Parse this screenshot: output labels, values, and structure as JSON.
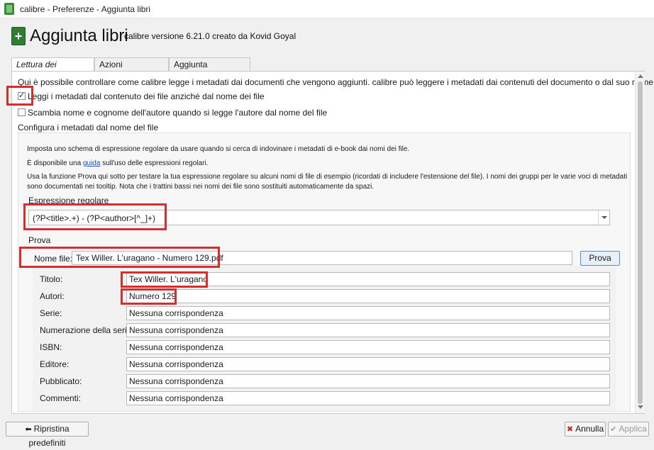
{
  "window": {
    "title": "calibre - Preferenze - Aggiunta libri"
  },
  "header": {
    "title": "Aggiunta libri",
    "subtitle": "calibre versione 6.21.0 creato da Kovid Goyal"
  },
  "tabs": [
    {
      "label": "Lettura dei metadati",
      "active": true
    },
    {
      "label": "Azioni all'aggiunta",
      "active": false
    },
    {
      "label": "Aggiunta automatica",
      "active": false
    }
  ],
  "panel": {
    "intro": "Qui è possibile controllare come calibre legge i metadati dai documenti che vengono aggiunti. calibre può leggere i metadati dai contenuti del documento o dal suo nome.",
    "checkbox_read_from_content": {
      "label": "Leggi i metadati dal contenuto dei file anziché dal nome dei file",
      "checked": true
    },
    "checkbox_swap_author": {
      "label": "Scambia nome e cognome dell'autore quando si legge l'autore dal nome del file",
      "checked": false
    },
    "section_title": "Configura i metadati dal nome del file"
  },
  "group": {
    "desc1": "Imposta uno schema di espressione regolare da usare quando si cerca di indovinare i metadati di e-book dai nomi dei file.",
    "desc2_before": "È disponibile una ",
    "desc2_link": "guida",
    "desc2_after": " sull'uso delle espressioni regolari.",
    "desc3_line1": "Usa la funzione Prova qui sotto per testare la tua espressione regolare su alcuni nomi di file di esempio (ricordati di includere l'estensione del file). I nomi dei gruppi per le varie voci di metadati",
    "desc3_line2": "sono documentati nei tooltip. Nota che i trattini bassi nei nomi dei file sono sostituiti automaticamente da spazi.",
    "regex_label": "Espressione regolare",
    "regex_value": "(?P<title>.+) - (?P<author>[^_]+)",
    "test_label": "Prova",
    "filename_label": "Nome file:",
    "filename_value": "Tex Willer. L'uragano - Numero 129.pdf",
    "test_button": "Prova"
  },
  "results": [
    {
      "label": "Titolo:",
      "value": "Tex Willer. L'uragano"
    },
    {
      "label": "Autori:",
      "value": "Numero 129"
    },
    {
      "label": "Serie:",
      "value": "Nessuna corrispondenza"
    },
    {
      "label": "Numerazione della serie:",
      "value": "Nessuna corrispondenza"
    },
    {
      "label": "ISBN:",
      "value": "Nessuna corrispondenza"
    },
    {
      "label": "Editore:",
      "value": "Nessuna corrispondenza"
    },
    {
      "label": "Pubblicato:",
      "value": "Nessuna corrispondenza"
    },
    {
      "label": "Commenti:",
      "value": "Nessuna corrispondenza"
    }
  ],
  "footer": {
    "restore_button": "Ripristina predefiniti",
    "cancel_button": "Annulla",
    "apply_button": "Applica"
  },
  "colors": {
    "highlight": "#d32f2f",
    "link": "#1a4fbf",
    "cancel_icon": "#c62828",
    "apply_icon": "#9a9a9a"
  }
}
